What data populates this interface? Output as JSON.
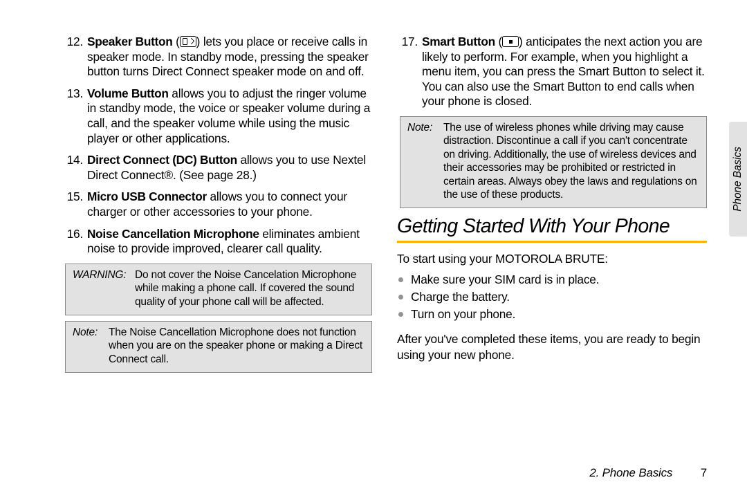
{
  "left": {
    "items": [
      {
        "num": "12.",
        "bold": "Speaker Button",
        "icon": "speaker",
        "rest": " lets you place or receive calls in speaker mode. In standby mode, pressing the speaker button turns Direct Connect speaker mode on and off."
      },
      {
        "num": "13.",
        "bold": "Volume Button",
        "rest": " allows you to adjust the ringer volume in standby mode, the voice or speaker volume during a call, and the speaker volume while using the music player or other applications."
      },
      {
        "num": "14.",
        "bold": "Direct Connect (DC) Button",
        "rest": " allows you to use Nextel Direct Connect®. (See page 28.)"
      },
      {
        "num": "15.",
        "bold": "Micro USB Connector",
        "rest": " allows you to connect your charger or other accessories to your phone."
      },
      {
        "num": "16.",
        "bold": "Noise Cancellation Microphone",
        "rest": " eliminates ambient noise to provide improved, clearer call quality."
      }
    ],
    "warning_label": "WARNING:",
    "warning_body": "Do not cover the Noise Cancelation Microphone while making a phone call.  If covered the sound quality of your phone call will be affected.",
    "note_label": "Note:",
    "note_body": "The Noise Cancellation Microphone does not function when you are on the speaker phone or making a Direct Connect call."
  },
  "right": {
    "item": {
      "num": "17.",
      "bold": "Smart Button",
      "icon": "dot",
      "rest": " anticipates the next action you are likely to perform. For example, when you highlight a menu item, you can press the Smart Button to select it. You can also use the Smart Button to end calls when your phone is closed."
    },
    "note_label": "Note:",
    "note_body": "The use of wireless phones while driving may cause distraction. Discontinue a call if you can't concentrate on driving. Additionally, the use of wireless devices and their accessories may be prohibited or restricted in certain areas. Always obey the laws and regulations on the use of these products.",
    "heading": "Getting Started With Your Phone",
    "intro": "To start using your MOTOROLA BRUTE:",
    "bullets": [
      "Make sure your SIM card is in place.",
      "Charge the battery.",
      "Turn on your phone."
    ],
    "outro": "After you've completed these items, you are ready to begin using your new phone."
  },
  "tab_label": "Phone Basics",
  "footer_chapter": "2. Phone Basics",
  "footer_page": "7"
}
